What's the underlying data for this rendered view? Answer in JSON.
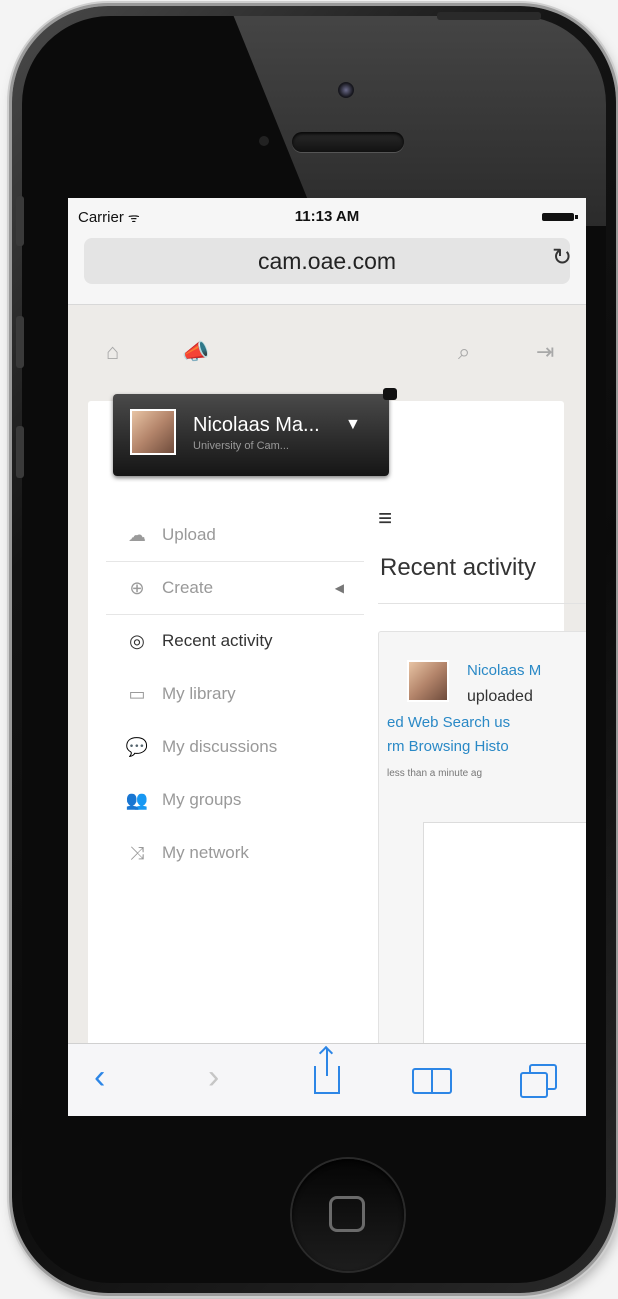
{
  "status": {
    "carrier": "Carrier",
    "time": "11:13 AM"
  },
  "browser": {
    "url": "cam.oae.com"
  },
  "topnav": {
    "home": "home-icon",
    "announce": "megaphone-icon",
    "search": "search-icon",
    "signout": "sign-out-icon"
  },
  "user": {
    "name": "Nicolaas Ma...",
    "org": "University of Cam..."
  },
  "menu": {
    "items": [
      {
        "label": "Upload",
        "icon": "cloud-upload-icon"
      },
      {
        "label": "Create",
        "icon": "plus-circle-icon"
      },
      {
        "label": "Recent activity",
        "icon": "dashboard-icon"
      },
      {
        "label": "My library",
        "icon": "briefcase-icon"
      },
      {
        "label": "My discussions",
        "icon": "comments-icon"
      },
      {
        "label": "My groups",
        "icon": "group-icon"
      },
      {
        "label": "My network",
        "icon": "shuffle-icon"
      }
    ]
  },
  "content": {
    "title": "Recent activity",
    "activity": {
      "actor": "Nicolaas M",
      "verb": "uploaded",
      "line1": "ed Web Search us",
      "line2": "rm Browsing Histo",
      "time": "less than a minute ag"
    }
  },
  "colors": {
    "link": "#2a89c6",
    "toolbar": "#2d86e6"
  }
}
